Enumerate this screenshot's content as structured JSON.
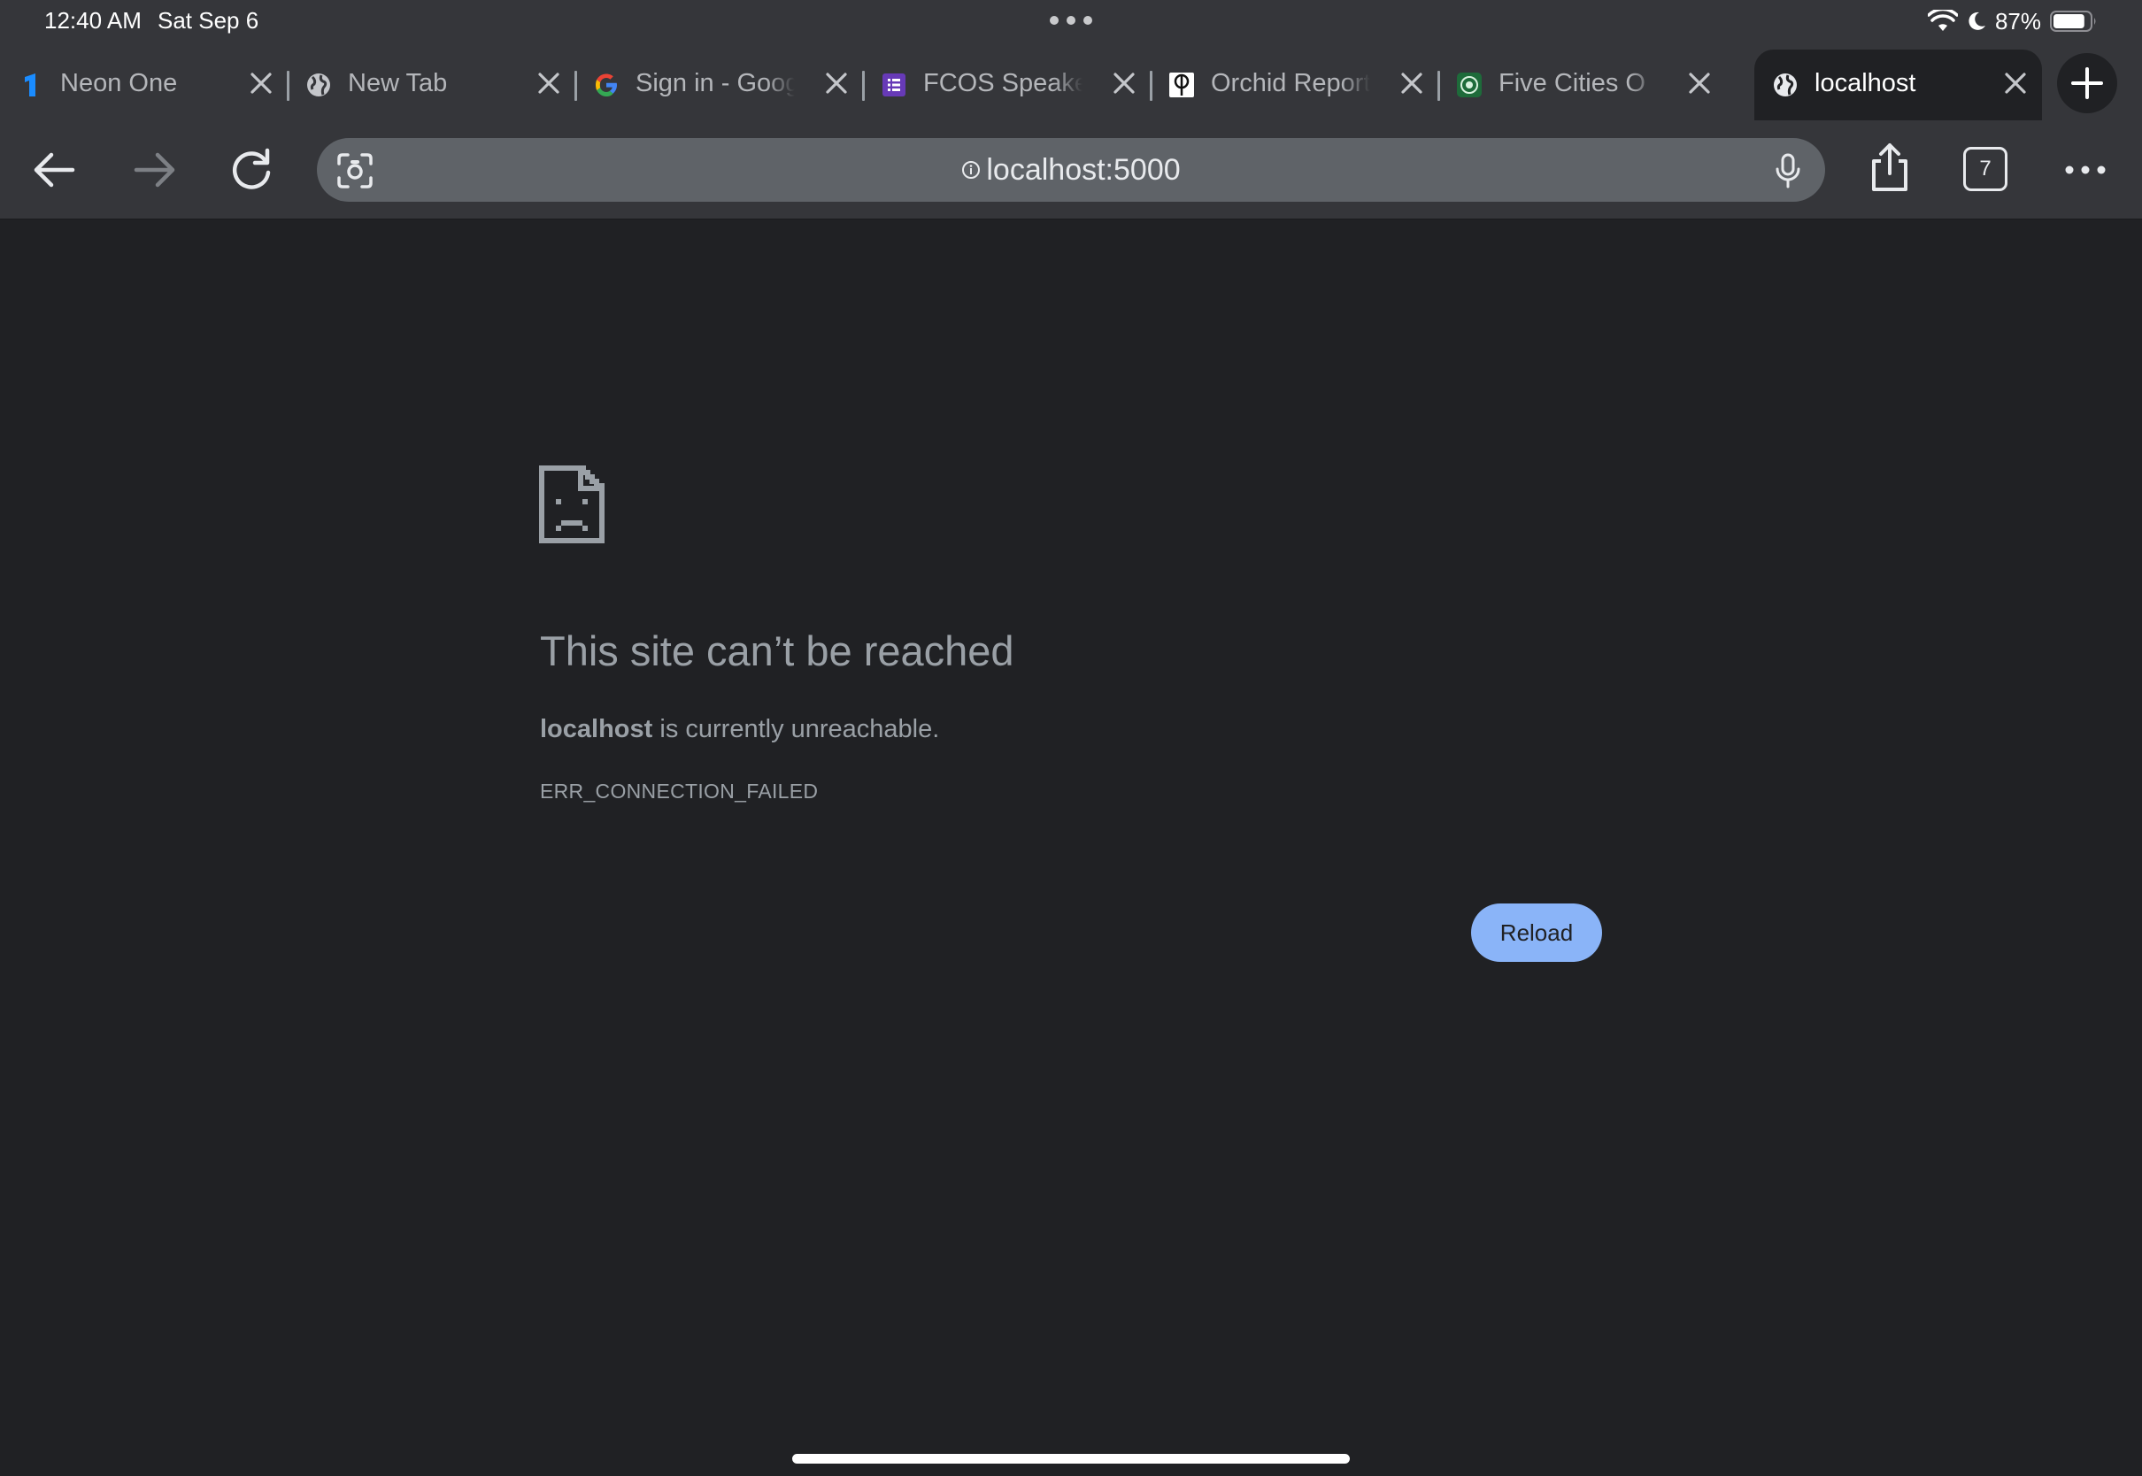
{
  "status_bar": {
    "time": "12:40 AM",
    "date": "Sat Sep 6",
    "battery_percent": "87%",
    "battery_level": 0.87
  },
  "tabs": [
    {
      "title": "Neon One",
      "icon": "neon-one-icon",
      "active": false
    },
    {
      "title": "New Tab",
      "icon": "globe-icon",
      "active": false
    },
    {
      "title": "Sign in - Google",
      "icon": "google-icon",
      "active": false
    },
    {
      "title": "FCOS Speakers",
      "icon": "forms-icon",
      "active": false
    },
    {
      "title": "Orchid Report",
      "icon": "orchid-icon",
      "active": false
    },
    {
      "title": "Five Cities O",
      "icon": "five-cities-icon",
      "active": false
    },
    {
      "title": "localhost",
      "icon": "globe-icon",
      "active": true
    }
  ],
  "toolbar": {
    "url": "localhost:5000",
    "tab_count": "7"
  },
  "error_page": {
    "heading": "This site can’t be reached",
    "host": "localhost",
    "message_suffix": " is currently unreachable.",
    "error_code": "ERR_CONNECTION_FAILED",
    "reload_label": "Reload"
  },
  "colors": {
    "background": "#202124",
    "chrome": "#35363a",
    "omnibox": "#5f6368",
    "accent": "#8ab4f8",
    "secondary_text": "#9aa0a6"
  }
}
